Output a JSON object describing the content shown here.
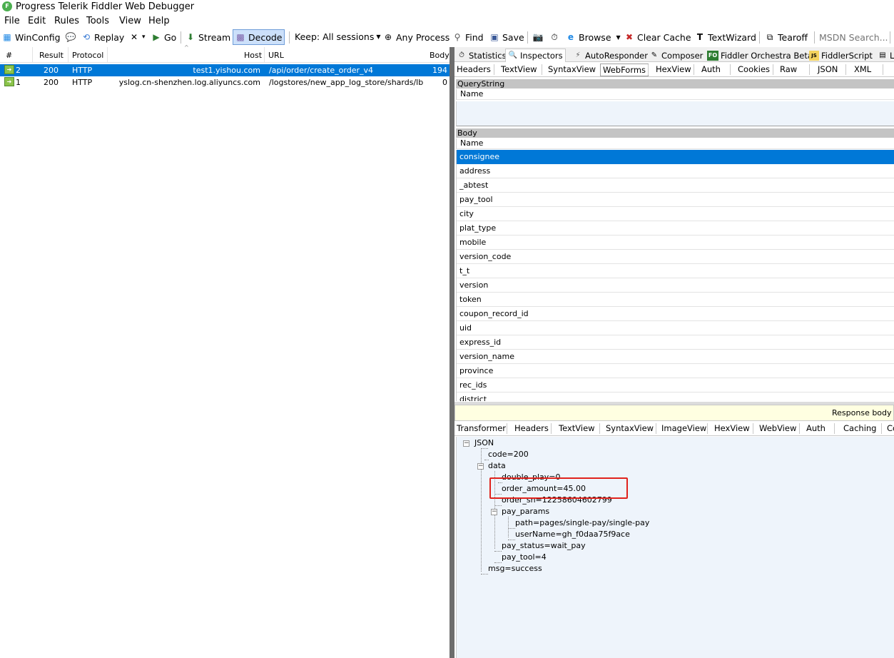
{
  "window": {
    "title": "Progress Telerik Fiddler Web Debugger",
    "logo": "F"
  },
  "menu": [
    "File",
    "Edit",
    "Rules",
    "Tools",
    "View",
    "Help"
  ],
  "toolbar": {
    "winconfig": "WinConfig",
    "replay": "Replay",
    "remove_arrow": "▾",
    "go": "Go",
    "stream": "Stream",
    "decode": "Decode",
    "keep": "Keep: All sessions",
    "any_process": "Any Process",
    "find": "Find",
    "save": "Save",
    "browse": "Browse",
    "clear_cache": "Clear Cache",
    "textwizard": "TextWizard",
    "tearoff": "Tearoff",
    "msdn_placeholder": "MSDN Search..."
  },
  "sessions": {
    "columns": [
      "#",
      "Result",
      "Protocol",
      "Host",
      "URL",
      "Body"
    ],
    "rows": [
      {
        "id": "2",
        "result": "200",
        "protocol": "HTTP",
        "host": "test1.yishou.com",
        "url": "/api/order/create_order_v4",
        "body": "194",
        "selected": true
      },
      {
        "id": "1",
        "result": "200",
        "protocol": "HTTP",
        "host": "yslog.cn-shenzhen.log.aliyuncs.com",
        "url": "/logstores/new_app_log_store/shards/lb",
        "body": "0",
        "selected": false
      }
    ]
  },
  "inspector": {
    "top_tabs": [
      "Statistics",
      "Inspectors",
      "AutoResponder",
      "Composer",
      "Fiddler Orchestra Beta",
      "FiddlerScript",
      "L"
    ],
    "top_icons": {
      "fo": "FO",
      "js": "JS"
    },
    "request_tabs": [
      "Headers",
      "TextView",
      "SyntaxView",
      "WebForms",
      "HexView",
      "Auth",
      "Cookies",
      "Raw",
      "JSON",
      "XML"
    ],
    "querystring_label": "QueryString",
    "name_col": "Name",
    "body_label": "Body",
    "body_fields": [
      "consignee",
      "address",
      "_abtest",
      "pay_tool",
      "city",
      "plat_type",
      "mobile",
      "version_code",
      "t_t",
      "version",
      "token",
      "coupon_record_id",
      "uid",
      "express_id",
      "version_name",
      "province",
      "rec_ids",
      "district"
    ],
    "response_warning": "Response body is",
    "response_tabs": [
      "Transformer",
      "Headers",
      "TextView",
      "SyntaxView",
      "ImageView",
      "HexView",
      "WebView",
      "Auth",
      "Caching",
      "Co"
    ],
    "tree": {
      "root": "JSON",
      "code": "code=200",
      "data": "data",
      "double_play": "double_play=0",
      "order_amount": "order_amount=45.00",
      "order_sn": "order_sn=12258604602799",
      "pay_params": "pay_params",
      "path": "path=pages/single-pay/single-pay",
      "username": "userName=gh_f0daa75f9ace",
      "pay_status": "pay_status=wait_pay",
      "pay_tool": "pay_tool=4",
      "msg": "msg=success"
    }
  },
  "colors": {
    "selection": "#0078d7",
    "splitter": "#6d6d6d",
    "highlight": "#e0231d",
    "tree_bg": "#eef4fb"
  }
}
